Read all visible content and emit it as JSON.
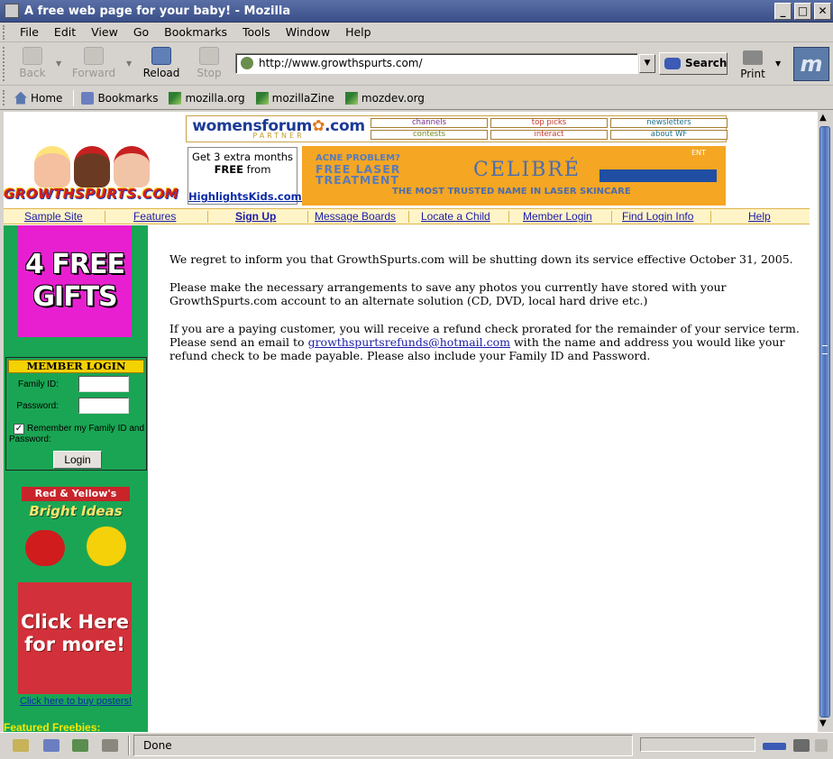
{
  "window": {
    "title": "A free web page for your baby! - Mozilla",
    "buttons": {
      "minimize": "_",
      "maximize": "□",
      "close": "✕"
    }
  },
  "menu": [
    "File",
    "Edit",
    "View",
    "Go",
    "Bookmarks",
    "Tools",
    "Window",
    "Help"
  ],
  "toolbar": {
    "back": "Back",
    "forward": "Forward",
    "reload": "Reload",
    "stop": "Stop",
    "url": "http://www.growthspurts.com/",
    "search": "Search",
    "print": "Print",
    "logo": "m"
  },
  "personal_toolbar": [
    "Home",
    "Bookmarks",
    "mozilla.org",
    "mozillaZine",
    "mozdev.org"
  ],
  "header": {
    "wf_logo": "womensforum",
    "wf_logo_suffix": ".com",
    "wf_partner": "PARTNER",
    "wf_links": [
      "channels",
      "top picks",
      "newsletters",
      "contests",
      "interact",
      "about WF"
    ],
    "hk_line1": "Get 3 extra months",
    "hk_line2": "FREE",
    "hk_line2b": "from",
    "hk_link": "HighlightsKids.com!",
    "celibre_acne": "ACNE PROBLEM?",
    "celibre_laser_1": "FREE LASER",
    "celibre_laser_2": "TREATMENT",
    "celibre_brand": "CELIBRÉ",
    "celibre_tag": "THE MOST TRUSTED NAME IN LASER SKINCARE",
    "celibre_ent": "ENT",
    "growthspurts_logo": "GROWTHSPURTS.COM"
  },
  "site_nav": [
    "Sample Site",
    "Features",
    "Sign Up",
    "Message Boards",
    "Locate a Child",
    "Member Login",
    "Find Login Info",
    "Help"
  ],
  "sidebar": {
    "gifts_promo_1": "4 FREE",
    "gifts_promo_2": "GIFTS",
    "login": {
      "title": "MEMBER LOGIN",
      "family_id_label": "Family ID:",
      "password_label": "Password:",
      "family_id_value": "",
      "password_value": "",
      "remember_label": "Remember my Family ID and Password:",
      "remember_checked": "✓",
      "login_button": "Login"
    },
    "mm_promo_title": "Red & Yellow's",
    "mm_promo_sub": "Bright Ideas",
    "click_promo_1": "Click Here",
    "click_promo_2": "for more!",
    "poster_link": "Click here to buy posters!",
    "featured": "Featured Freebies:"
  },
  "message": {
    "p1": "We regret to inform you that GrowthSpurts.com will be shutting down its service effective October 31, 2005.",
    "p2": "Please make the necessary arrangements to save any photos you currently have stored with your GrowthSpurts.com account to an alternate solution (CD, DVD, local hard drive etc.)",
    "p3_before": "If you are a paying customer, you will receive a refund check prorated for the remainder of your service term. Please send an email to ",
    "p3_email": "growthspurtsrefunds@hotmail.com",
    "p3_after": " with the name and address you would like your refund check to be made payable. Please also include your Family ID and Password."
  },
  "status": {
    "text": "Done"
  }
}
